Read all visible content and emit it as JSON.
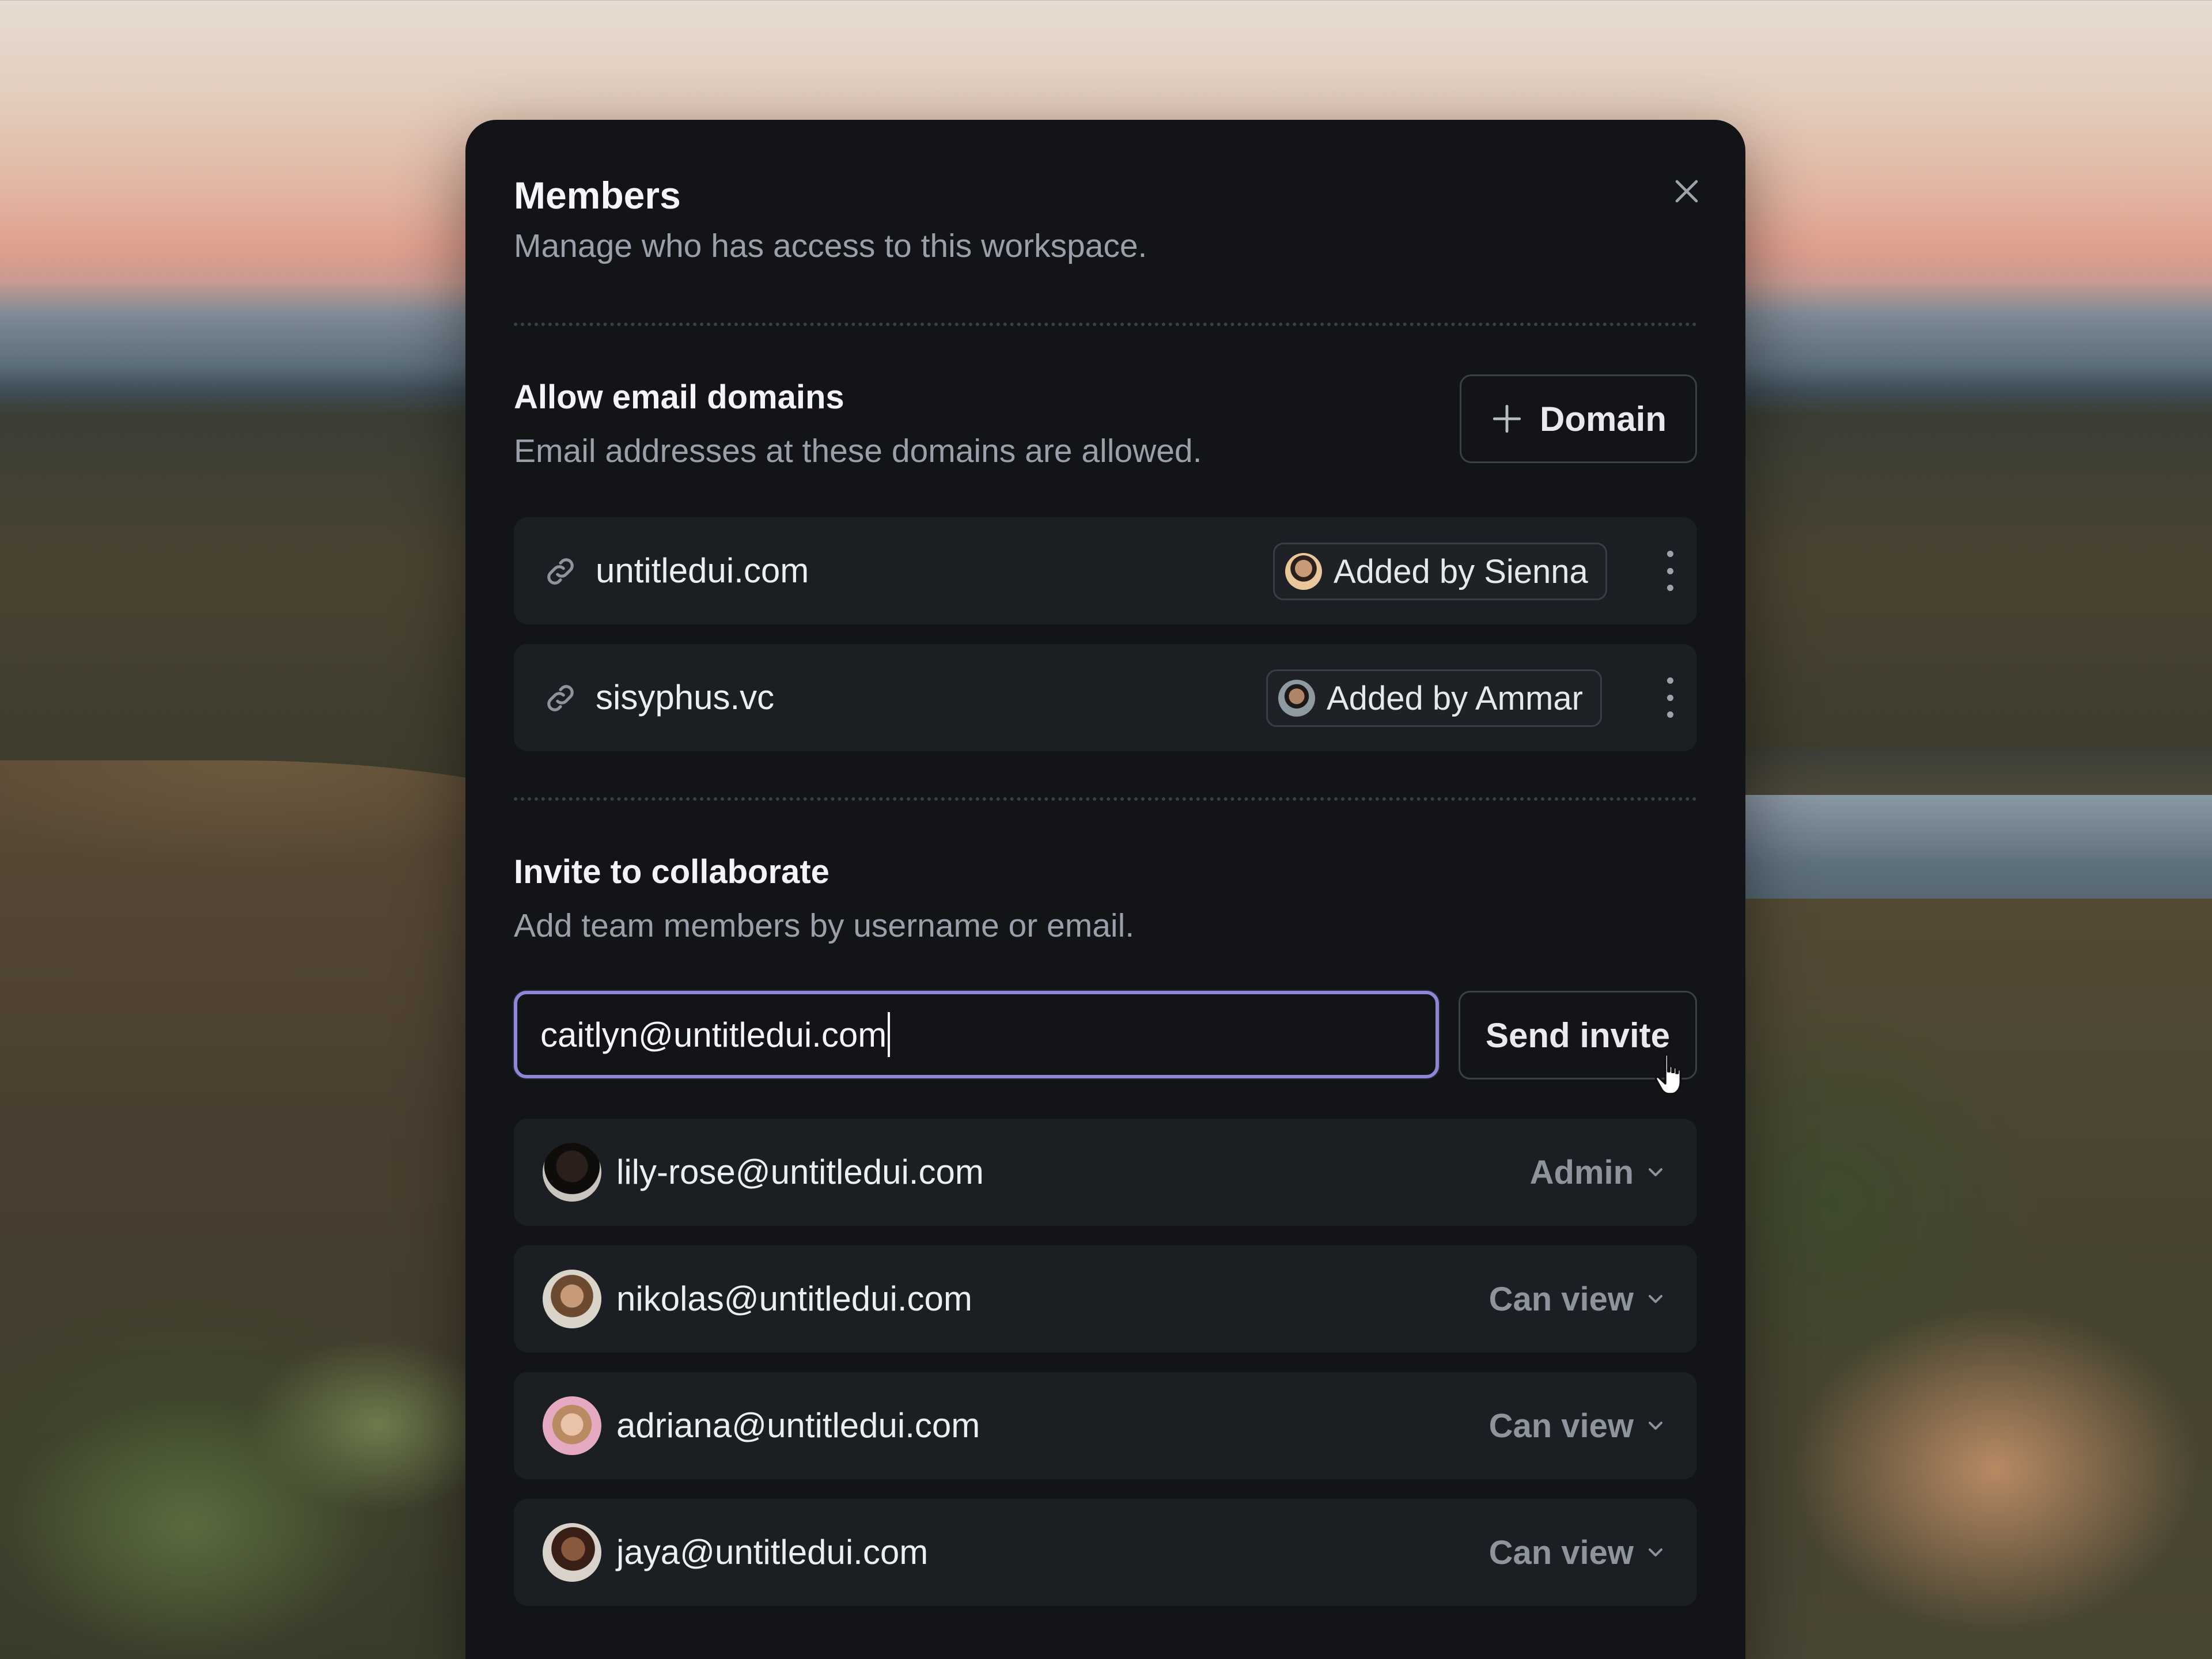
{
  "modal": {
    "title": "Members",
    "subtitle": "Manage who has access to this workspace.",
    "close_icon": "close-icon"
  },
  "domains": {
    "title": "Allow email domains",
    "subtitle": "Email addresses at these domains are allowed.",
    "add_button_label": "Domain",
    "items": [
      {
        "domain": "untitledui.com",
        "added_by": "Added by Sienna",
        "icon": "link-icon"
      },
      {
        "domain": "sisyphus.vc",
        "added_by": "Added by Ammar",
        "icon": "link-icon"
      }
    ]
  },
  "invite": {
    "title": "Invite to collaborate",
    "subtitle": "Add team members by username or email.",
    "input_value": "caitlyn@untitledui.com",
    "send_button_label": "Send invite"
  },
  "members": [
    {
      "email": "lily-rose@untitledui.com",
      "role": "Admin"
    },
    {
      "email": "nikolas@untitledui.com",
      "role": "Can view"
    },
    {
      "email": "adriana@untitledui.com",
      "role": "Can view"
    },
    {
      "email": "jaya@untitledui.com",
      "role": "Can view"
    }
  ],
  "colors": {
    "modal_bg": "#121418",
    "row_bg": "#1b1e23",
    "focus_ring": "#8f86d8",
    "muted_text": "#9aa0a9"
  }
}
